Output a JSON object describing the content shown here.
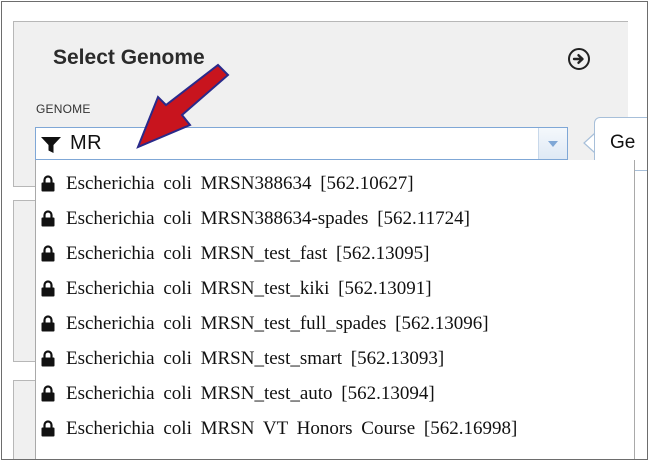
{
  "panel": {
    "title": "Select Genome",
    "field_label": "GENOME",
    "filter_value": "MR",
    "tooltip_text": "Ge"
  },
  "icons": {
    "filter": "filter-icon",
    "next": "arrow-circle-right-icon",
    "dropdown": "chevron-down-icon",
    "lock": "lock-icon",
    "annotation": "red-arrow-icon"
  },
  "colors": {
    "panel_bg": "#f0f0f0",
    "combo_border": "#7fa7d6",
    "annotation_arrow": "#c8141e",
    "annotation_arrow_outline": "#2a2a8a"
  },
  "genomes": [
    {
      "name": "Escherichia coli MRSN388634 [562.10627]"
    },
    {
      "name": "Escherichia coli MRSN388634-spades [562.11724]"
    },
    {
      "name": "Escherichia coli MRSN_test_fast [562.13095]"
    },
    {
      "name": "Escherichia coli MRSN_test_kiki [562.13091]"
    },
    {
      "name": "Escherichia coli MRSN_test_full_spades [562.13096]"
    },
    {
      "name": "Escherichia coli MRSN_test_smart [562.13093]"
    },
    {
      "name": "Escherichia coli MRSN_test_auto [562.13094]"
    },
    {
      "name": "Escherichia coli MRSN VT Honors Course [562.16998]"
    }
  ]
}
